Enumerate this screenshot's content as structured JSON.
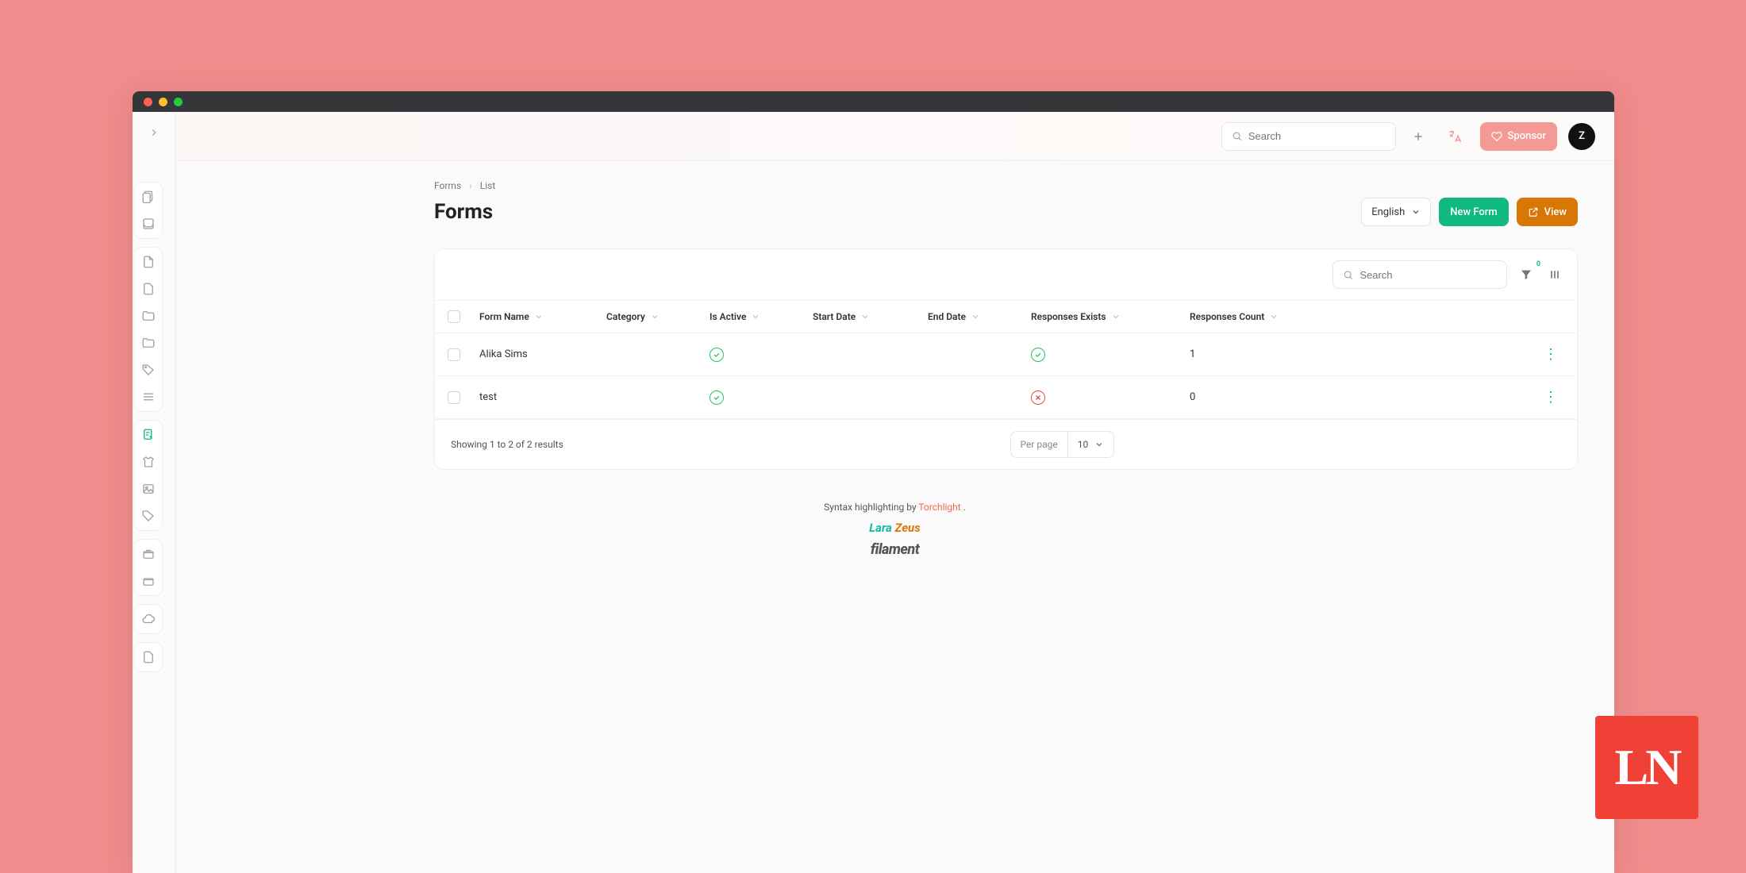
{
  "header": {
    "search_placeholder": "Search",
    "sponsor_label": "Sponsor",
    "avatar_initial": "Z"
  },
  "breadcrumb": {
    "root": "Forms",
    "leaf": "List"
  },
  "page": {
    "title": "Forms"
  },
  "actions": {
    "language_label": "English",
    "new_form_label": "New Form",
    "view_label": "View"
  },
  "table": {
    "search_placeholder": "Search",
    "filter_count": "0",
    "columns": {
      "form_name": "Form Name",
      "category": "Category",
      "is_active": "Is Active",
      "start_date": "Start Date",
      "end_date": "End Date",
      "responses_exists": "Responses Exists",
      "responses_count": "Responses Count"
    },
    "rows": [
      {
        "form_name": "Alika Sims",
        "is_active": true,
        "responses_exists": true,
        "responses_count": "1"
      },
      {
        "form_name": "test",
        "is_active": true,
        "responses_exists": false,
        "responses_count": "0"
      }
    ],
    "footer": {
      "summary": "Showing 1 to 2 of 2 results",
      "per_page_label": "Per page",
      "per_page_value": "10"
    }
  },
  "credits": {
    "syntax_text": "Syntax highlighting by ",
    "torchlight": "Torchlight",
    "dot": " .",
    "lara": "Lara ",
    "zeus": "Zeus",
    "filament": "filament"
  },
  "badge": {
    "text": "LN"
  }
}
